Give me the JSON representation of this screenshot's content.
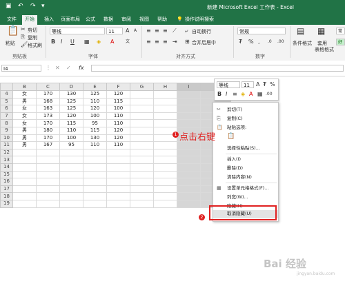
{
  "app": {
    "window_title": "新建 Microsoft Excel 工作表 - Excel",
    "tabs": [
      "文件",
      "开始",
      "插入",
      "页面布局",
      "公式",
      "数据",
      "审阅",
      "视图",
      "帮助"
    ],
    "active_tab": "开始",
    "tell_me": "操作说明搜索",
    "accent_color": "#217346"
  },
  "ribbon": {
    "clipboard": {
      "paste": "粘贴",
      "cut": "剪切",
      "copy": "复制",
      "format_painter": "格式刷",
      "label": "剪贴板"
    },
    "font": {
      "name": "等线",
      "size": "11",
      "label": "字体",
      "bold": "B",
      "italic": "I",
      "underline": "U"
    },
    "alignment": {
      "wrap": "自动换行",
      "merge": "合并后居中",
      "label": "对齐方式"
    },
    "number": {
      "format": "常规",
      "label": "数字"
    },
    "styles": {
      "conditional": "条件格式",
      "table": "套用",
      "table2": "表格格式",
      "normal": "常",
      "good": "好"
    }
  },
  "formula_bar": {
    "name_box": "I4",
    "fx": "fx",
    "value": ""
  },
  "sheet": {
    "columns": [
      "B",
      "C",
      "D",
      "E",
      "F",
      "G",
      "H",
      "I",
      "J"
    ],
    "rows": [
      {
        "num": "4",
        "cells": [
          "女",
          "170",
          "130",
          "125",
          "120",
          "",
          "",
          "",
          ""
        ]
      },
      {
        "num": "5",
        "cells": [
          "男",
          "168",
          "125",
          "110",
          "115",
          "",
          "",
          "",
          ""
        ]
      },
      {
        "num": "6",
        "cells": [
          "女",
          "163",
          "125",
          "120",
          "100",
          "",
          "",
          "",
          ""
        ]
      },
      {
        "num": "7",
        "cells": [
          "女",
          "173",
          "120",
          "100",
          "110",
          "",
          "",
          "",
          ""
        ]
      },
      {
        "num": "8",
        "cells": [
          "女",
          "170",
          "115",
          "95",
          "110",
          "",
          "",
          "",
          ""
        ]
      },
      {
        "num": "9",
        "cells": [
          "男",
          "180",
          "110",
          "115",
          "120",
          "",
          "",
          "",
          ""
        ]
      },
      {
        "num": "10",
        "cells": [
          "男",
          "170",
          "100",
          "130",
          "120",
          "",
          "",
          "",
          ""
        ]
      },
      {
        "num": "11",
        "cells": [
          "男",
          "167",
          "95",
          "110",
          "110",
          "",
          "",
          "",
          ""
        ]
      },
      {
        "num": "12",
        "cells": [
          "",
          "",
          "",
          "",
          "",
          "",
          "",
          "",
          ""
        ]
      },
      {
        "num": "13",
        "cells": [
          "",
          "",
          "",
          "",
          "",
          "",
          "",
          "",
          ""
        ]
      },
      {
        "num": "14",
        "cells": [
          "",
          "",
          "",
          "",
          "",
          "",
          "",
          "",
          ""
        ]
      },
      {
        "num": "15",
        "cells": [
          "",
          "",
          "",
          "",
          "",
          "",
          "",
          "",
          ""
        ]
      },
      {
        "num": "16",
        "cells": [
          "",
          "",
          "",
          "",
          "",
          "",
          "",
          "",
          ""
        ]
      },
      {
        "num": "17",
        "cells": [
          "",
          "",
          "",
          "",
          "",
          "",
          "",
          "",
          ""
        ]
      },
      {
        "num": "18",
        "cells": [
          "",
          "",
          "",
          "",
          "",
          "",
          "",
          "",
          ""
        ]
      },
      {
        "num": "19",
        "cells": [
          "",
          "",
          "",
          "",
          "",
          "",
          "",
          "",
          ""
        ]
      }
    ]
  },
  "mini_toolbar": {
    "font": "等线",
    "size": "11",
    "percent": "%"
  },
  "context_menu": {
    "items": [
      "剪切(T)",
      "复制(C)",
      "粘贴选项:",
      "",
      "选择性粘贴(S)...",
      "插入(I)",
      "删除(D)",
      "清除内容(N)",
      "设置单元格格式(F)...",
      "列宽(W)...",
      "隐藏(H)",
      "取消隐藏(U)"
    ]
  },
  "annotations": {
    "step1_num": "1",
    "step1_text": "点击右键",
    "step2_num": "2",
    "color": "#e02020"
  },
  "watermark": {
    "brand": "Bai 经验",
    "url": "jingyan.baidu.com"
  }
}
